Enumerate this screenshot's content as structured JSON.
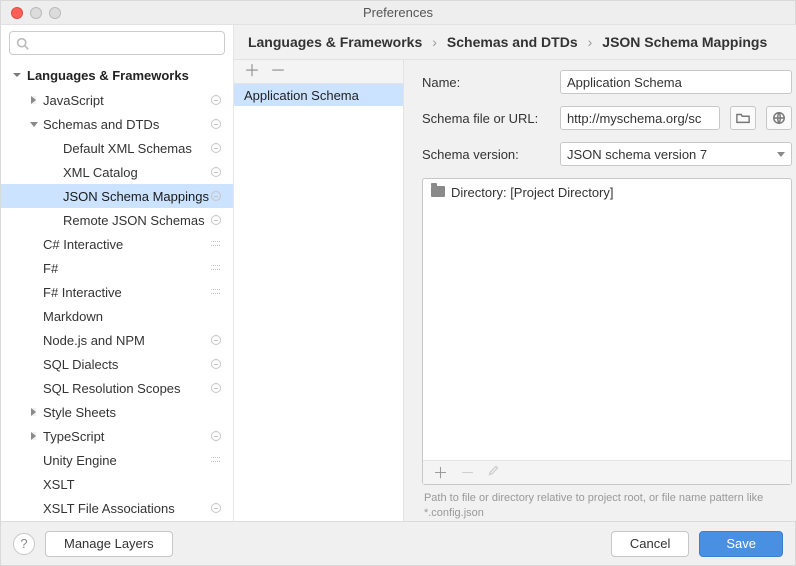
{
  "window": {
    "title": "Preferences"
  },
  "breadcrumbs": {
    "a": "Languages & Frameworks",
    "b": "Schemas and DTDs",
    "c": "JSON Schema Mappings"
  },
  "sidebar": {
    "heading": "Languages & Frameworks",
    "items": [
      {
        "label": "JavaScript",
        "level": 1,
        "arrow": "right",
        "badge": "circle"
      },
      {
        "label": "Schemas and DTDs",
        "level": 1,
        "arrow": "down",
        "badge": "circle"
      },
      {
        "label": "Default XML Schemas",
        "level": 2,
        "badge": "circle"
      },
      {
        "label": "XML Catalog",
        "level": 2,
        "badge": "circle"
      },
      {
        "label": "JSON Schema Mappings",
        "level": 2,
        "badge": "circle",
        "selected": true
      },
      {
        "label": "Remote JSON Schemas",
        "level": 2,
        "badge": "circle"
      },
      {
        "label": "C# Interactive",
        "level": 1,
        "badge": "stack"
      },
      {
        "label": "F#",
        "level": 1,
        "badge": "stack"
      },
      {
        "label": "F# Interactive",
        "level": 1,
        "badge": "stack"
      },
      {
        "label": "Markdown",
        "level": 1
      },
      {
        "label": "Node.js and NPM",
        "level": 1,
        "badge": "circle"
      },
      {
        "label": "SQL Dialects",
        "level": 1,
        "badge": "circle"
      },
      {
        "label": "SQL Resolution Scopes",
        "level": 1,
        "badge": "circle"
      },
      {
        "label": "Style Sheets",
        "level": 1,
        "arrow": "right"
      },
      {
        "label": "TypeScript",
        "level": 1,
        "arrow": "right",
        "badge": "circle"
      },
      {
        "label": "Unity Engine",
        "level": 1,
        "badge": "stack"
      },
      {
        "label": "XSLT",
        "level": 1
      },
      {
        "label": "XSLT File Associations",
        "level": 1,
        "badge": "circle"
      }
    ]
  },
  "mappings": {
    "selected": "Application Schema"
  },
  "form": {
    "nameLabel": "Name:",
    "nameValue": "Application Schema",
    "urlLabel": "Schema file or URL:",
    "urlValue": "http://myschema.org/sc",
    "versionLabel": "Schema version:",
    "versionValue": "JSON schema version 7",
    "scopeLabelPrefix": "Directory: ",
    "scopeLabelValue": "[Project Directory]",
    "hint": "Path to file or directory relative to project root, or file name pattern like *.config.json"
  },
  "footer": {
    "manage": "Manage Layers",
    "cancel": "Cancel",
    "save": "Save"
  }
}
